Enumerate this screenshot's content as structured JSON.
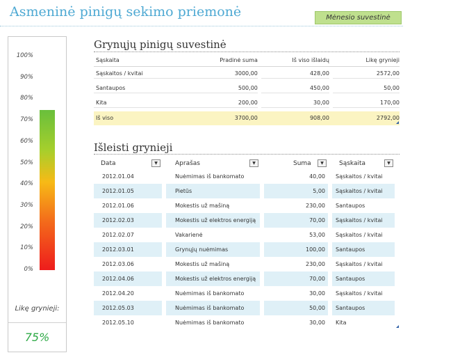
{
  "app_title": "Asmeninė pinigų sekimo priemonė",
  "summary_button": "Mėnesio suvestinė",
  "gauge": {
    "labels": [
      "100%",
      "90%",
      "80%",
      "70%",
      "60%",
      "50%",
      "40%",
      "30%",
      "20%",
      "10%",
      "0%"
    ],
    "fill_fraction": 0.75,
    "remaining_label": "Likę grynieji:",
    "remaining_value": "75%"
  },
  "summary": {
    "title": "Grynųjų pinigų suvestinė",
    "headers": [
      "Sąskaita",
      "Pradinė suma",
      "Iš viso išlaidų",
      "Likę grynieji"
    ],
    "rows": [
      [
        "Sąskaitos / kvitai",
        "3000,00",
        "428,00",
        "2572,00"
      ],
      [
        "Santaupos",
        "500,00",
        "450,00",
        "50,00"
      ],
      [
        "Kita",
        "200,00",
        "30,00",
        "170,00"
      ]
    ],
    "total": [
      "Iš viso",
      "3700,00",
      "908,00",
      "2792,00"
    ]
  },
  "spent": {
    "title": "Išleisti grynieji",
    "headers": [
      "Data",
      "Aprašas",
      "Suma",
      "Sąskaita"
    ],
    "dropdown_glyph": "▼",
    "rows": [
      [
        "2012.01.04",
        "Nuėmimas iš bankomato",
        "40,00",
        "Sąskaitos / kvitai"
      ],
      [
        "2012.01.05",
        "Pietūs",
        "5,00",
        "Sąskaitos / kvitai"
      ],
      [
        "2012.01.06",
        "Mokestis už mašiną",
        "230,00",
        "Santaupos"
      ],
      [
        "2012.02.03",
        "Mokestis už elektros energiją",
        "70,00",
        "Sąskaitos / kvitai"
      ],
      [
        "2012.02.07",
        "Vakarienė",
        "53,00",
        "Sąskaitos / kvitai"
      ],
      [
        "2012.03.01",
        "Grynųjų nuėmimas",
        "100,00",
        "Santaupos"
      ],
      [
        "2012.03.06",
        "Mokestis už mašiną",
        "230,00",
        "Sąskaitos / kvitai"
      ],
      [
        "2012.04.06",
        "Mokestis už elektros energiją",
        "70,00",
        "Santaupos"
      ],
      [
        "2012.04.20",
        "Nuėmimas iš bankomato",
        "30,00",
        "Sąskaitos / kvitai"
      ],
      [
        "2012.05.03",
        "Nuėmimas iš bankomato",
        "50,00",
        "Santaupos"
      ],
      [
        "2012.05.10",
        "Nuėmimas iš bankomato",
        "30,00",
        "Kita"
      ]
    ]
  }
}
